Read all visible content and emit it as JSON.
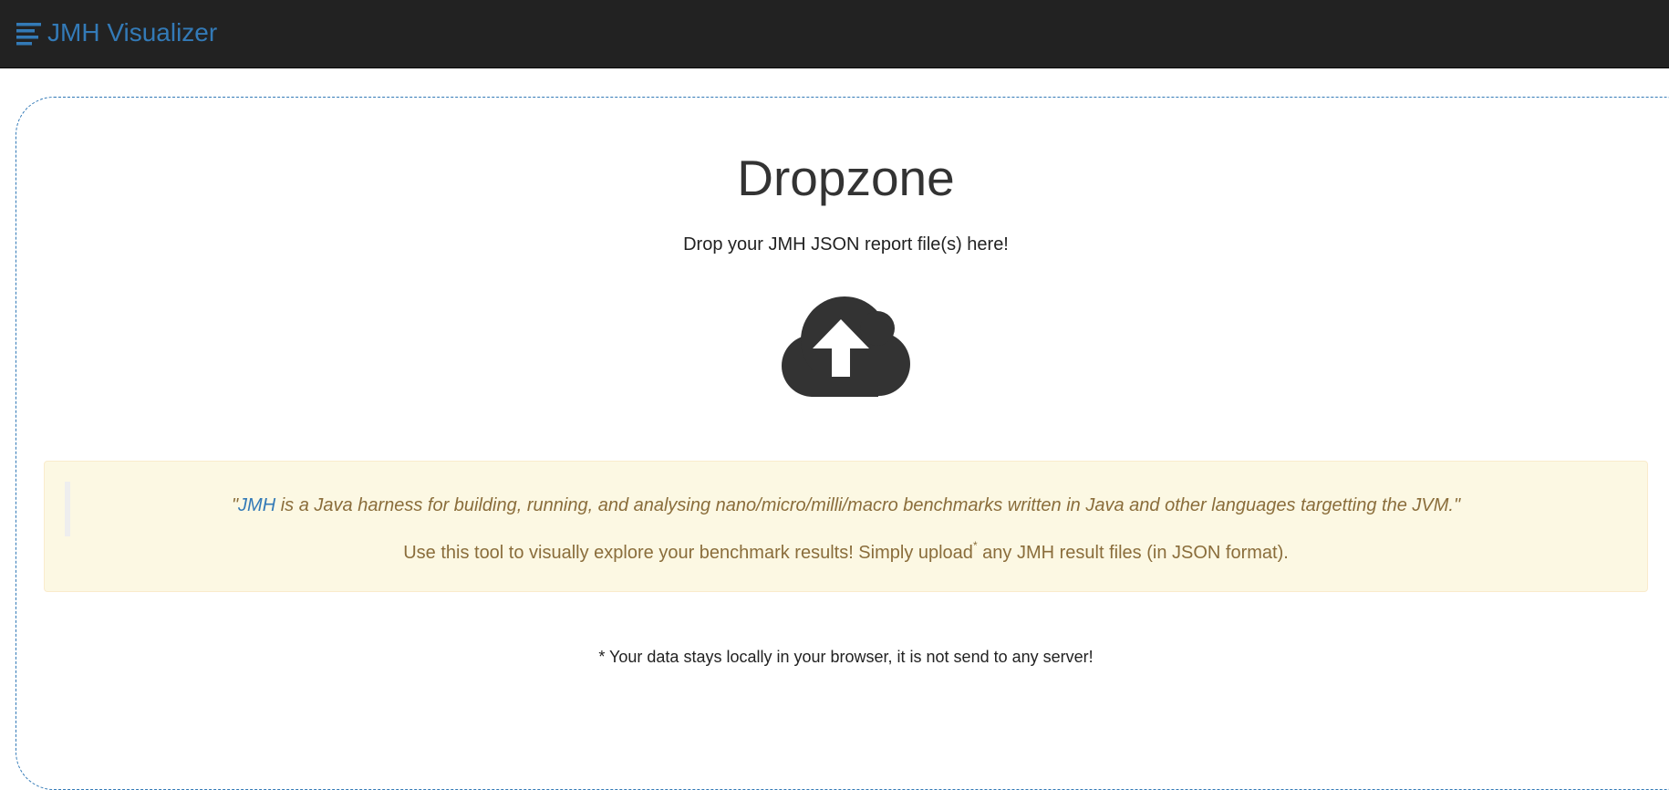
{
  "navbar": {
    "brand_icon": "align-left-icon",
    "brand_label": "JMH Visualizer",
    "brand_color": "#337ab7",
    "background": "#222222"
  },
  "dropzone": {
    "title": "Dropzone",
    "subtitle": "Drop your JMH JSON report file(s) here!",
    "upload_icon": "cloud-upload-icon"
  },
  "info": {
    "quote_open": "\"",
    "quote_link": "JMH",
    "quote_rest": " is a Java harness for building, running, and analysing nano/micro/milli/macro benchmarks written in Java and other languages targetting the JVM.\"",
    "usage_before": "Use this tool to visually explore your benchmark results! Simply upload",
    "usage_mark": "*",
    "usage_after": " any JMH result files (in JSON format)."
  },
  "footnote": "* Your data stays locally in your browser, it is not send to any server!"
}
